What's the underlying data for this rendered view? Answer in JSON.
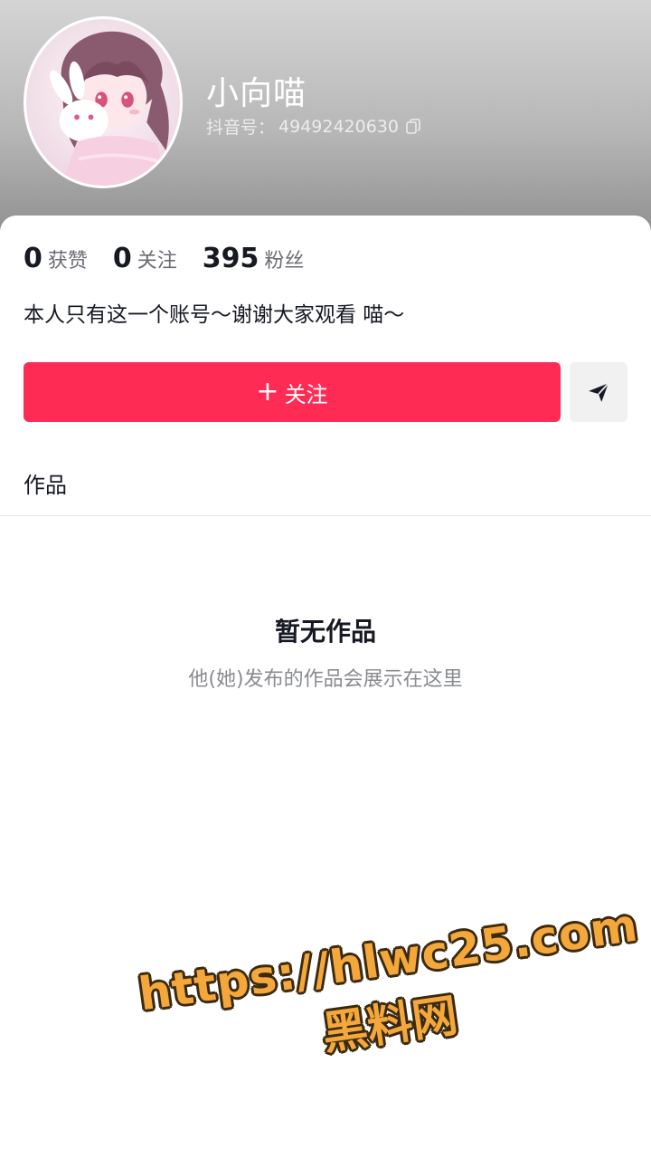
{
  "profile": {
    "nickname": "小向喵",
    "uid_label": "抖音号：",
    "uid_value": "49492420630",
    "avatar_icon": "anime-girl-avatar",
    "copy_icon": "copy-icon"
  },
  "stats": [
    {
      "value": "0",
      "label": "获赞"
    },
    {
      "value": "0",
      "label": "关注"
    },
    {
      "value": "395",
      "label": "粉丝"
    }
  ],
  "bio": "本人只有这一个账号～谢谢大家观看 喵～",
  "actions": {
    "follow_plus": "+",
    "follow_label": "关注",
    "share_icon": "send-icon",
    "follow_color": "#fe2c55"
  },
  "tabs": {
    "works": "作品"
  },
  "empty_state": {
    "title": "暂无作品",
    "subtitle": "他(她)发布的作品会展示在这里"
  },
  "watermark": {
    "url": "https://hlwc25.com",
    "site": "黑料网",
    "color": "#f4a73a"
  }
}
